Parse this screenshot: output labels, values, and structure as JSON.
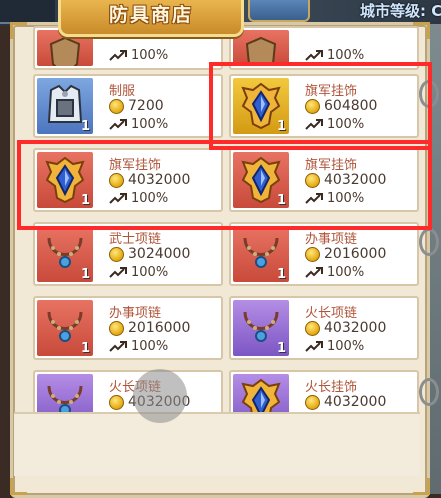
{
  "header": {
    "title": "防具商店",
    "city_level_label": "城市等级: C"
  },
  "items": [
    {
      "name": "",
      "price": "",
      "pct": "100%",
      "qty": "",
      "icon": "shield-icon",
      "color": "red"
    },
    {
      "name": "",
      "price": "",
      "pct": "100%",
      "qty": "",
      "icon": "shield-icon",
      "color": "red"
    },
    {
      "name": "制服",
      "price": "7200",
      "pct": "100%",
      "qty": "1",
      "icon": "uniform-icon",
      "color": "blue"
    },
    {
      "name": "旗军挂饰",
      "price": "604800",
      "pct": "100%",
      "qty": "1",
      "icon": "banner-pendant-icon",
      "color": "gold"
    },
    {
      "name": "旗军挂饰",
      "price": "4032000",
      "pct": "100%",
      "qty": "1",
      "icon": "banner-pendant-icon",
      "color": "red"
    },
    {
      "name": "旗军挂饰",
      "price": "4032000",
      "pct": "100%",
      "qty": "1",
      "icon": "banner-pendant-icon",
      "color": "red"
    },
    {
      "name": "武士项链",
      "price": "3024000",
      "pct": "100%",
      "qty": "1",
      "icon": "necklace-icon",
      "color": "red"
    },
    {
      "name": "办事项链",
      "price": "2016000",
      "pct": "100%",
      "qty": "1",
      "icon": "necklace-icon",
      "color": "red"
    },
    {
      "name": "办事项链",
      "price": "2016000",
      "pct": "100%",
      "qty": "1",
      "icon": "necklace-icon",
      "color": "red"
    },
    {
      "name": "火长项链",
      "price": "4032000",
      "pct": "100%",
      "qty": "1",
      "icon": "necklace-icon",
      "color": "purple"
    },
    {
      "name": "火长项链",
      "price": "4032000",
      "pct": "100%",
      "qty": "",
      "icon": "necklace-icon",
      "color": "purple"
    },
    {
      "name": "火长挂饰",
      "price": "4032000",
      "pct": "100%",
      "qty": "",
      "icon": "banner-pendant-icon",
      "color": "purple"
    }
  ],
  "colors": {
    "highlight": "#ff2a2a",
    "name_text": "#b0553a",
    "panel_bg": "#f1e8d6"
  }
}
